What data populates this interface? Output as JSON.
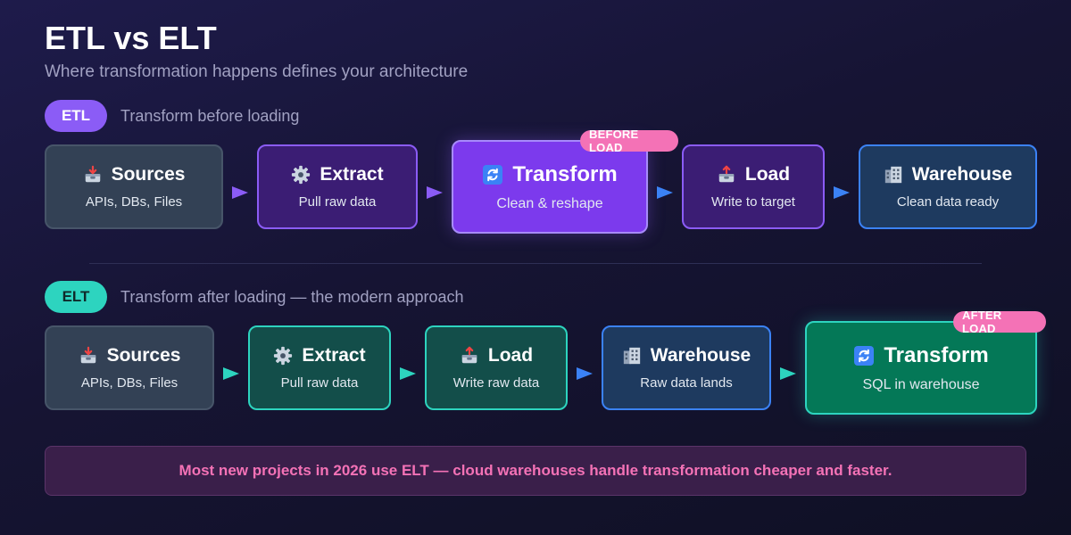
{
  "title": "ETL vs ELT",
  "subtitle": "Where transformation happens defines your architecture",
  "etl": {
    "pill": "ETL",
    "description": "Transform before loading",
    "badge": "BEFORE LOAD",
    "steps": [
      {
        "icon": "inbox-tray-icon",
        "title": "Sources",
        "sub": "APIs, DBs, Files"
      },
      {
        "icon": "gear-icon",
        "title": "Extract",
        "sub": "Pull raw data"
      },
      {
        "icon": "cycle-arrows-icon",
        "title": "Transform",
        "sub": "Clean & reshape"
      },
      {
        "icon": "outbox-tray-icon",
        "title": "Load",
        "sub": "Write to target"
      },
      {
        "icon": "building-icon",
        "title": "Warehouse",
        "sub": "Clean data ready"
      }
    ]
  },
  "elt": {
    "pill": "ELT",
    "description": "Transform after loading — the modern approach",
    "badge": "AFTER LOAD",
    "steps": [
      {
        "icon": "inbox-tray-icon",
        "title": "Sources",
        "sub": "APIs, DBs, Files"
      },
      {
        "icon": "gear-icon",
        "title": "Extract",
        "sub": "Pull raw data"
      },
      {
        "icon": "outbox-tray-icon",
        "title": "Load",
        "sub": "Write raw data"
      },
      {
        "icon": "building-icon",
        "title": "Warehouse",
        "sub": "Raw data lands"
      },
      {
        "icon": "cycle-arrows-icon",
        "title": "Transform",
        "sub": "SQL in warehouse"
      }
    ]
  },
  "note": "Most new projects in 2026 use ELT — cloud warehouses handle transformation cheaper and faster.",
  "colors": {
    "etl_accent": "#8b5cf6",
    "elt_accent": "#2dd4bf",
    "badge": "#f472b6",
    "warehouse_blue": "#3b82f6"
  }
}
